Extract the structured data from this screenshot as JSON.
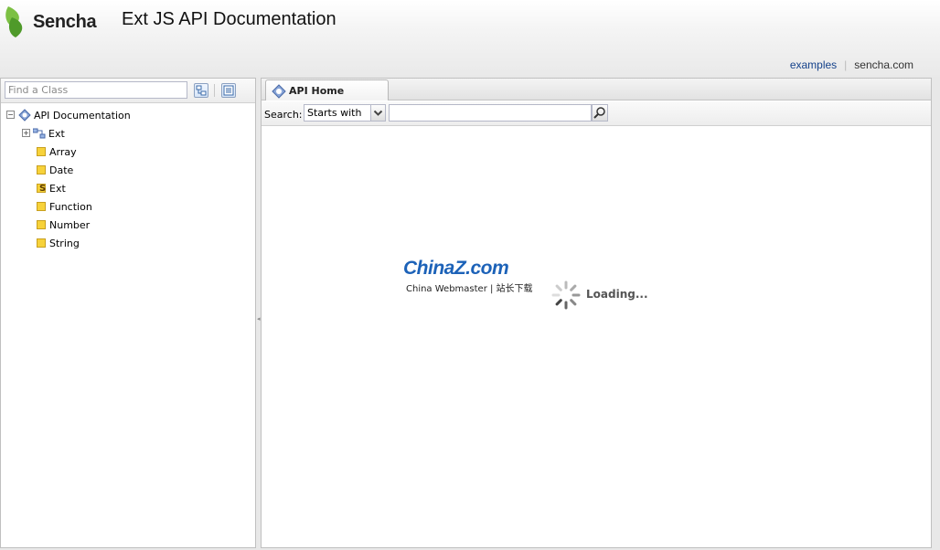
{
  "header": {
    "logo_text": "Sencha",
    "title": "Ext JS API Documentation",
    "links": {
      "examples": "examples",
      "sencha": "sencha.com"
    }
  },
  "west": {
    "find_placeholder": "Find a Class",
    "tree": {
      "root": "API Documentation",
      "package": "Ext",
      "items": [
        "Array",
        "Date",
        "Ext",
        "Function",
        "Number",
        "String"
      ]
    }
  },
  "center": {
    "tab_label": "API Home",
    "search": {
      "label": "Search:",
      "mode": "Starts with",
      "value": ""
    },
    "watermark": {
      "brand": "ChinaZ.com",
      "subtitle": "China Webmaster | 站长下载"
    },
    "loading_text": "Loading..."
  },
  "colors": {
    "accent": "#15428b",
    "class_icon": "#f7d23a",
    "watermark_blue": "#1c62b8"
  }
}
